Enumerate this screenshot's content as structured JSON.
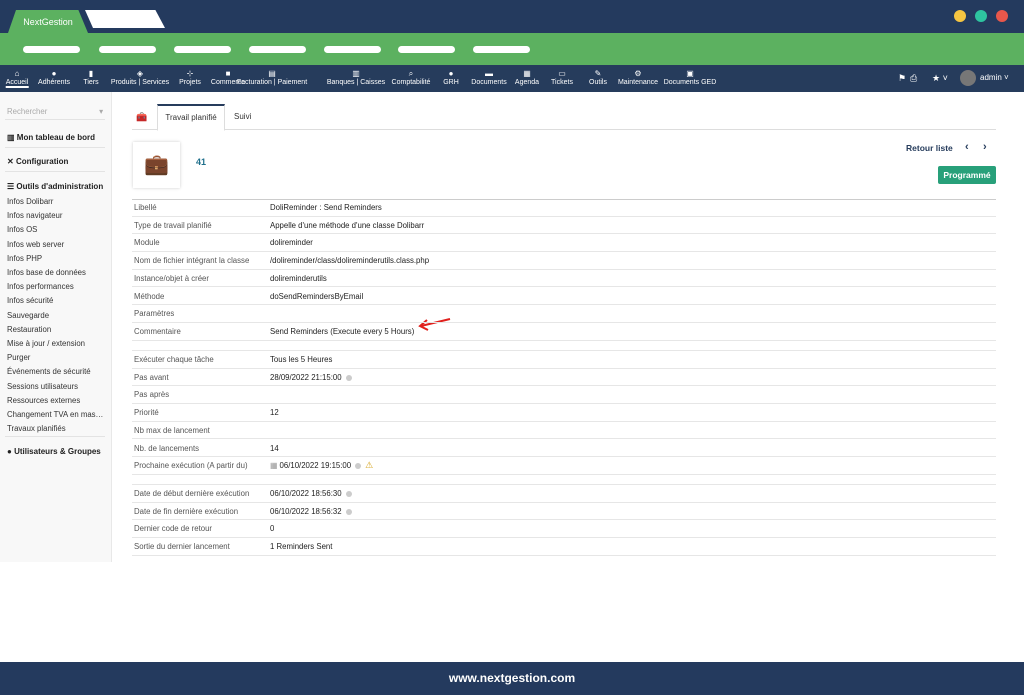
{
  "app": {
    "brand": "NextGestion",
    "footer": "www.nextgestion.com"
  },
  "colors": {
    "navy": "#243a5e",
    "green": "#5cb160",
    "accent": "#28a07a",
    "link": "#1f6f8b"
  },
  "nav": [
    {
      "label": "Accueil",
      "icon": "home-icon",
      "g": "⌂"
    },
    {
      "label": "Adhérents",
      "icon": "user-icon",
      "g": "●"
    },
    {
      "label": "Tiers",
      "icon": "building-icon",
      "g": "▮"
    },
    {
      "label": "Produits | Services",
      "icon": "cube-icon",
      "g": "◈"
    },
    {
      "label": "Projets",
      "icon": "sitemap-icon",
      "g": "⊹"
    },
    {
      "label": "Commerce",
      "icon": "briefcase-icon",
      "g": "■"
    },
    {
      "label": "Facturation | Paiement",
      "icon": "money-icon",
      "g": "▤"
    },
    {
      "label": "Banques | Caisses",
      "icon": "bank-icon",
      "g": "▥"
    },
    {
      "label": "Comptabilité",
      "icon": "search-dollar-icon",
      "g": "⌕"
    },
    {
      "label": "GRH",
      "icon": "user-tie-icon",
      "g": "●"
    },
    {
      "label": "Documents",
      "icon": "folder-icon",
      "g": "▬"
    },
    {
      "label": "Agenda",
      "icon": "calendar-icon",
      "g": "▦"
    },
    {
      "label": "Tickets",
      "icon": "ticket-icon",
      "g": "▭"
    },
    {
      "label": "Outils",
      "icon": "wrench-icon",
      "g": "✎"
    },
    {
      "label": "Maintenance",
      "icon": "cog-icon",
      "g": "⚙"
    },
    {
      "label": "Documents GED",
      "icon": "ged-icon",
      "g": "▣"
    }
  ],
  "user": {
    "name": "admin"
  },
  "sidebar": {
    "search_placeholder": "Rechercher",
    "dashboard": "Mon tableau de bord",
    "configuration": "Configuration",
    "admin_tools": "Outils d'administration",
    "items": [
      "Infos Dolibarr",
      "Infos navigateur",
      "Infos OS",
      "Infos web server",
      "Infos PHP",
      "Infos base de données",
      "Infos performances",
      "Infos sécurité",
      "Sauvegarde",
      "Restauration",
      "Mise à jour / extension",
      "Purger",
      "Événements de sécurité",
      "Sessions utilisateurs",
      "Ressources externes",
      "Changement TVA en mas…",
      "Travaux planifiés"
    ],
    "users_groups": "Utilisateurs & Groupes"
  },
  "tabs": [
    {
      "label": "Travail planifié",
      "active": true
    },
    {
      "label": "Suivi",
      "active": false
    }
  ],
  "record": {
    "id": "41",
    "back": "Retour liste",
    "status": "Programmé"
  },
  "fields1": [
    {
      "k": "Libellé",
      "v": "DoliReminder : Send Reminders"
    },
    {
      "k": "Type de travail planifié",
      "v": "Appelle d'une méthode d'une classe Dolibarr"
    },
    {
      "k": "Module",
      "v": "dolireminder"
    },
    {
      "k": "Nom de fichier intégrant la classe",
      "v": "/dolireminder/class/dolireminderutils.class.php"
    },
    {
      "k": "Instance/objet à créer",
      "v": "dolireminderutils"
    },
    {
      "k": "Méthode",
      "v": "doSendRemindersByEmail"
    },
    {
      "k": "Paramètres",
      "v": ""
    },
    {
      "k": "Commentaire",
      "v": "Send Reminders (Execute every 5 Hours)"
    }
  ],
  "fields2": [
    {
      "k": "Exécuter chaque tâche",
      "v": "Tous les 5 Heures"
    },
    {
      "k": "Pas avant",
      "v": "28/09/2022 21:15:00",
      "info": true
    },
    {
      "k": "Pas après",
      "v": ""
    },
    {
      "k": "Priorité",
      "v": "12"
    },
    {
      "k": "Nb max de lancement",
      "v": ""
    },
    {
      "k": "Nb. de lancements",
      "v": "14"
    },
    {
      "k": "Prochaine exécution (A partir du)",
      "v": "06/10/2022 19:15:00",
      "info": true,
      "warn": true,
      "cal": true
    }
  ],
  "fields3": [
    {
      "k": "Date de début dernière exécution",
      "v": "06/10/2022 18:56:30",
      "info": true
    },
    {
      "k": "Date de fin dernière exécution",
      "v": "06/10/2022 18:56:32",
      "info": true
    },
    {
      "k": "Dernier code de retour",
      "v": "0"
    },
    {
      "k": "Sortie du dernier lancement",
      "v": "1 Reminders Sent"
    }
  ]
}
